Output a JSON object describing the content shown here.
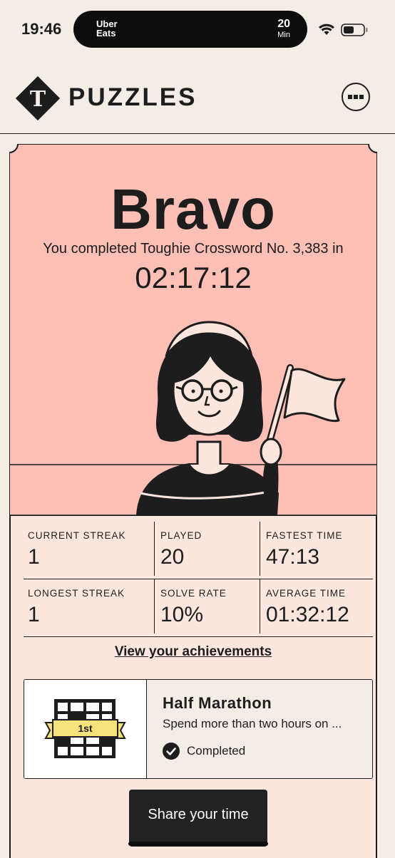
{
  "status_bar": {
    "time": "19:46",
    "live_activity": {
      "app": "Uber Eats",
      "minutes": "20",
      "unit": "Min"
    }
  },
  "header": {
    "brand": "PUZZLES",
    "menu_icon": "more-dots-icon",
    "logo_letter": "T"
  },
  "result": {
    "headline": "Bravo",
    "message": "You completed Toughie Crossword No. 3,383 in",
    "time": "02:17:12"
  },
  "stats": [
    [
      {
        "label": "CURRENT STREAK",
        "value": "1"
      },
      {
        "label": "PLAYED",
        "value": "20"
      },
      {
        "label": "FASTEST TIME",
        "value": "47:13"
      }
    ],
    [
      {
        "label": "LONGEST STREAK",
        "value": "1"
      },
      {
        "label": "SOLVE RATE",
        "value": "10%"
      },
      {
        "label": "AVERAGE TIME",
        "value": "01:32:12"
      }
    ]
  ],
  "achievements_link": "View your achievements",
  "achievement": {
    "badge_text": "1st",
    "title": "Half Marathon",
    "description": "Spend more than two hours on ...",
    "status": "Completed"
  },
  "share_button": "Share your time",
  "colors": {
    "card_top": "#fdbfb6",
    "card_body": "#fde6dd",
    "background": "#f3ede5",
    "badge": "#f6e27a",
    "dark": "#1d1d1d"
  }
}
